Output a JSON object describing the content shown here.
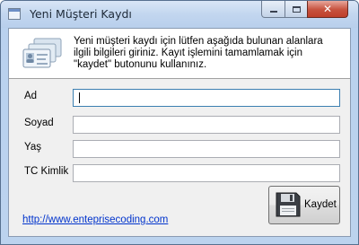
{
  "window": {
    "title": "Yeni Müşteri Kaydı",
    "caption_buttons": {
      "minimize": "minimize-icon",
      "maximize": "maximize-icon",
      "close": "close-icon",
      "close_glyph": "✕"
    }
  },
  "header": {
    "icon": "id-cards-icon",
    "description": "Yeni müşteri kaydı için lütfen aşağıda bulunan alanlara ilgili bilgileri giriniz. Kayıt işlemini tamamlamak için \"kaydet\" butonunu kullanınız."
  },
  "form": {
    "fields": [
      {
        "label": "Ad",
        "value": ""
      },
      {
        "label": "Soyad",
        "value": ""
      },
      {
        "label": "Yaş",
        "value": ""
      },
      {
        "label": "TC Kimlik",
        "value": ""
      }
    ]
  },
  "footer": {
    "link_text": "http://www.enteprisecoding.com",
    "save_button": {
      "label": "Kaydet",
      "icon": "floppy-disk-icon"
    }
  },
  "colors": {
    "link": "#0033cc",
    "close_button": "#c6513d",
    "focus_border": "#3c7fb1"
  }
}
